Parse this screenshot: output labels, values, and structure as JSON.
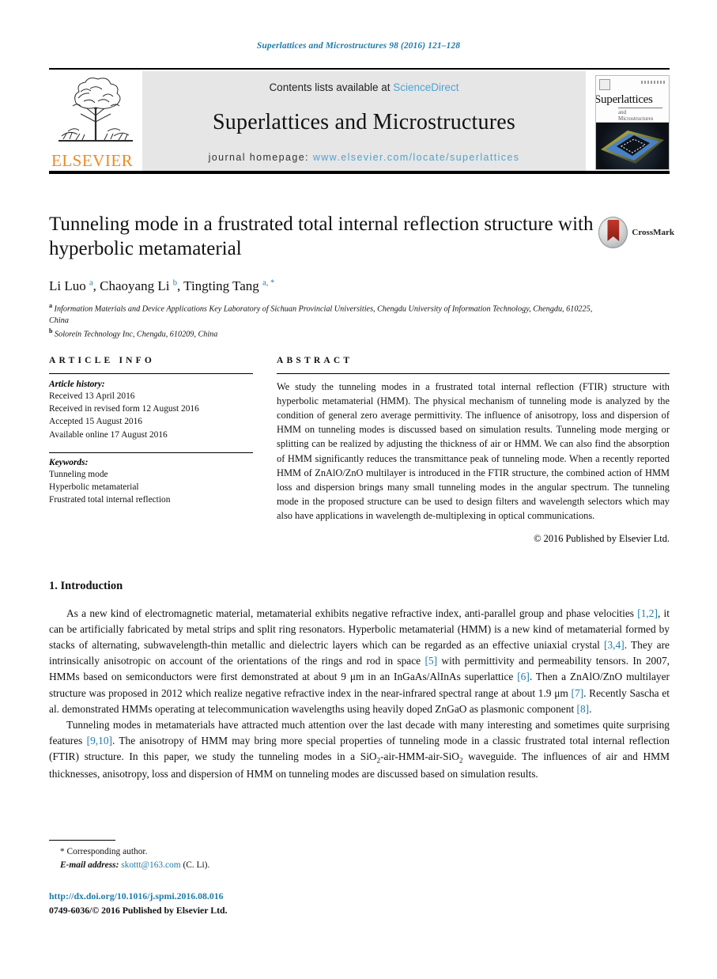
{
  "running_head": "Superlattices and Microstructures 98 (2016) 121–128",
  "masthead": {
    "publisher_name": "ELSEVIER",
    "contents_prefix": "Contents lists available at ",
    "sciencedirect": "ScienceDirect",
    "journal_name": "Superlattices and Microstructures",
    "homepage_prefix": "journal homepage: ",
    "homepage_url": "www.elsevier.com/locate/superlattices",
    "cover_title": "Superlattices",
    "cover_subtitle": "and Microstructures"
  },
  "article": {
    "title": "Tunneling mode in a frustrated total internal reflection structure with hyperbolic metamaterial",
    "authors_html": "Li Luo <sup>a</sup>, Chaoyang Li <sup>b</sup>, Tingting Tang <sup>a, *</sup>",
    "affiliation_a": "Information Materials and Device Applications Key Laboratory of Sichuan Provincial Universities, Chengdu University of Information Technology, Chengdu, 610225, China",
    "affiliation_b": "Solorein Technology Inc, Chengdu, 610209, China",
    "crossmark_label": "CrossMark"
  },
  "article_info": {
    "heading": "ARTICLE INFO",
    "history_label": "Article history:",
    "history": [
      "Received 13 April 2016",
      "Received in revised form 12 August 2016",
      "Accepted 15 August 2016",
      "Available online 17 August 2016"
    ],
    "keywords_label": "Keywords:",
    "keywords": [
      "Tunneling mode",
      "Hyperbolic metamaterial",
      "Frustrated total internal reflection"
    ]
  },
  "abstract": {
    "heading": "ABSTRACT",
    "text": "We study the tunneling modes in a frustrated total internal reflection (FTIR) structure with hyperbolic metamaterial (HMM). The physical mechanism of tunneling mode is analyzed by the condition of general zero average permittivity. The influence of anisotropy, loss and dispersion of HMM on tunneling modes is discussed based on simulation results. Tunneling mode merging or splitting can be realized by adjusting the thickness of air or HMM. We can also find the absorption of HMM significantly reduces the transmittance peak of tunneling mode. When a recently reported HMM of ZnAlO/ZnO multilayer is introduced in the FTIR structure, the combined action of HMM loss and dispersion brings many small tunneling modes in the angular spectrum. The tunneling mode in the proposed structure can be used to design filters and wavelength selectors which may also have applications in wavelength de-multiplexing in optical communications.",
    "copyright": "© 2016 Published by Elsevier Ltd."
  },
  "body": {
    "section_number_title": "1. Introduction",
    "paragraph_1_html": "As a new kind of electromagnetic material, metamaterial exhibits negative refractive index, anti-parallel group and phase velocities <span class=\"ref\">[1,2]</span>, it can be artificially fabricated by metal strips and split ring resonators. Hyperbolic metamaterial (HMM) is a new kind of metamaterial formed by stacks of alternating, subwavelength-thin metallic and dielectric layers which can be regarded as an effective uniaxial crystal <span class=\"ref\">[3,4]</span>. They are intrinsically anisotropic on account of the orientations of the rings and rod in space <span class=\"ref\">[5]</span> with permittivity and permeability tensors. In 2007, HMMs based on semiconductors were first demonstrated at about 9 μm in an InGaAs/AlInAs superlattice <span class=\"ref\">[6]</span>. Then a ZnAlO/ZnO multilayer structure was proposed in 2012 which realize negative refractive index in the near-infrared spectral range at about 1.9 μm <span class=\"ref\">[7]</span>. Recently Sascha et al. demonstrated HMMs operating at telecommunication wavelengths using heavily doped ZnGaO as plasmonic component <span class=\"ref\">[8]</span>.",
    "paragraph_2_html": "Tunneling modes in metamaterials have attracted much attention over the last decade with many interesting and sometimes quite surprising features <span class=\"ref\">[9,10]</span>. The anisotropy of HMM may bring more special properties of tunneling mode in a classic frustrated total internal reflection (FTIR) structure. In this paper, we study the tunneling modes in a SiO<sub>2</sub>-air-HMM-air-SiO<sub>2</sub> waveguide. The influences of air and HMM thicknesses, anisotropy, loss and dispersion of HMM on tunneling modes are discussed based on simulation results."
  },
  "footnote": {
    "corresponding": "* Corresponding author.",
    "email_label": "E-mail address:",
    "email": "skottt@163.com",
    "email_suffix": "(C. Li).",
    "doi": "http://dx.doi.org/10.1016/j.spmi.2016.08.016",
    "issn": "0749-6036/© 2016 Published by Elsevier Ltd."
  },
  "colors": {
    "link_blue": "#1f7ba8",
    "sciencedirect_blue": "#4ea3d0",
    "elsevier_orange": "#ec8b22",
    "masthead_gray": "#e6e6e6"
  }
}
